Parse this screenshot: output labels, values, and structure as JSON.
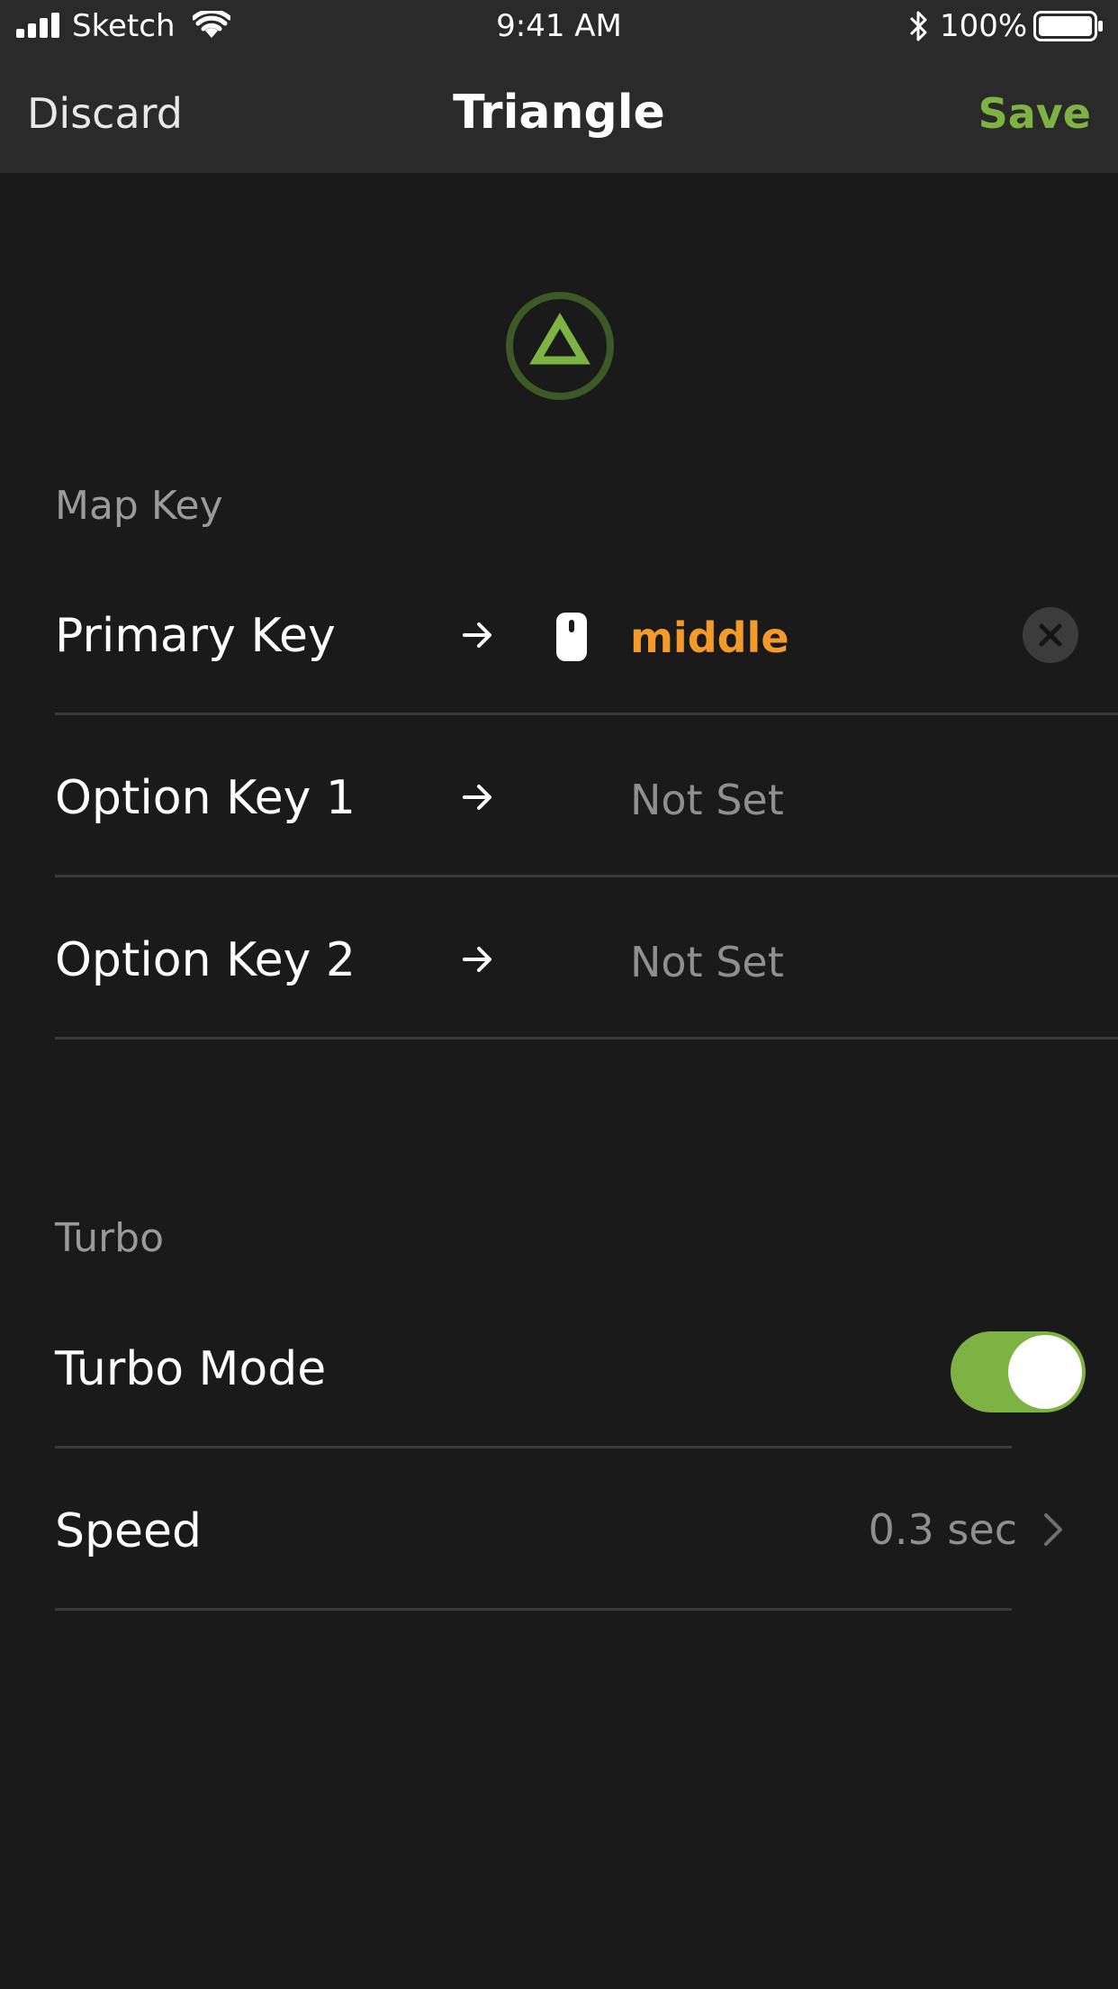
{
  "status_bar": {
    "carrier": "Sketch",
    "time": "9:41 AM",
    "battery_percent": "100%",
    "icons": [
      "signal-icon",
      "wifi-icon",
      "bluetooth-icon",
      "battery-icon"
    ]
  },
  "nav": {
    "discard_label": "Discard",
    "title": "Triangle",
    "save_label": "Save"
  },
  "hero_icon": "triangle-button-icon",
  "map_key": {
    "header": "Map Key",
    "rows": [
      {
        "label": "Primary Key",
        "value": "middle",
        "icon": "mouse-icon",
        "state": "set"
      },
      {
        "label": "Option Key 1",
        "value": "Not Set",
        "state": "unset"
      },
      {
        "label": "Option Key 2",
        "value": "Not Set",
        "state": "unset"
      }
    ]
  },
  "turbo": {
    "header": "Turbo",
    "mode_label": "Turbo Mode",
    "mode_on": true,
    "speed_label": "Speed",
    "speed_value": "0.3 sec"
  },
  "colors": {
    "accent_green": "#7cb342",
    "value_orange": "#f39a2b",
    "background": "#1a1a1a",
    "bar_background": "#2a2a2a"
  }
}
